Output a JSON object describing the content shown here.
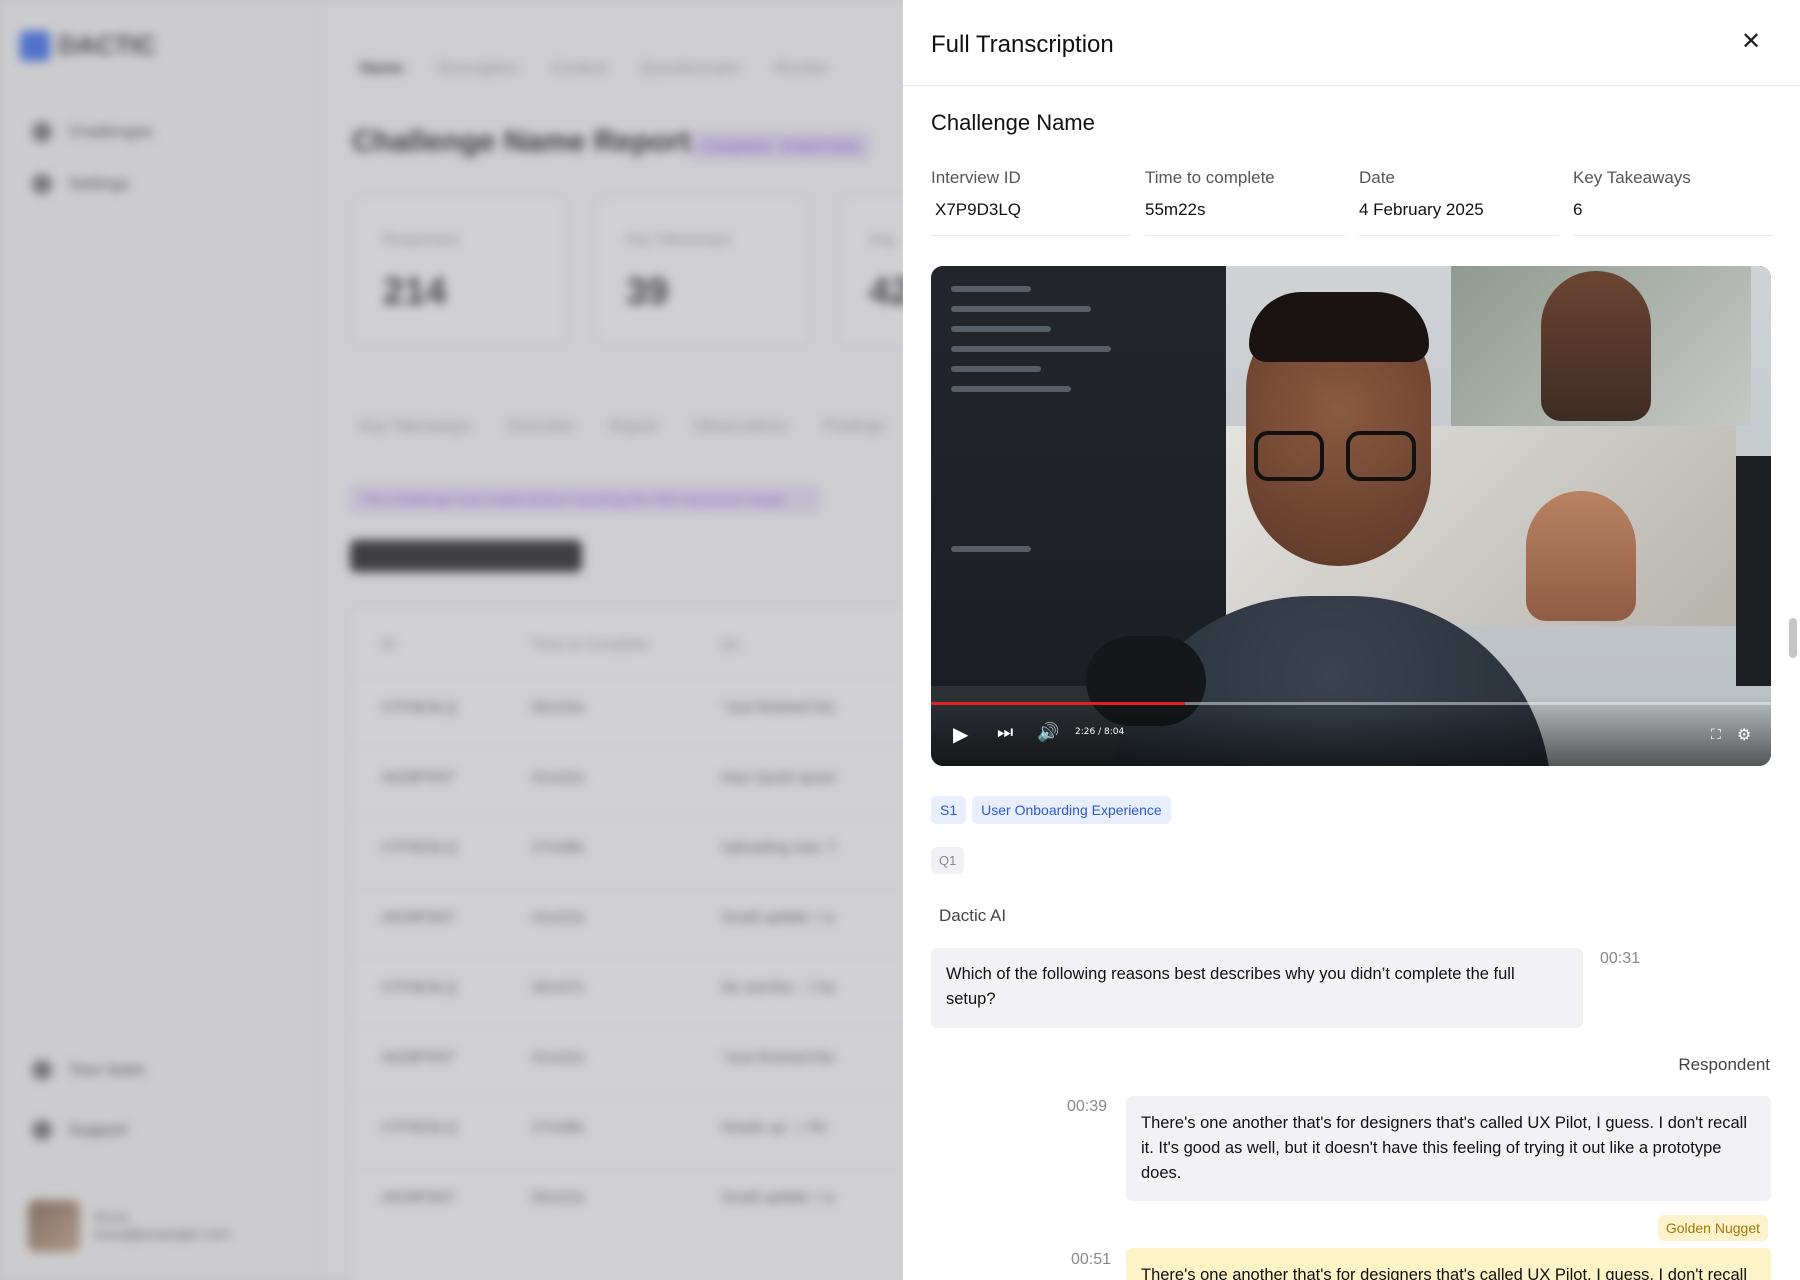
{
  "background": {
    "brand": "DACTIC",
    "nav": [
      "Challenges",
      "Settings"
    ],
    "bottom_nav": [
      "Your team",
      "Support"
    ],
    "user": {
      "name": "Erica",
      "email": "erica@example.com"
    },
    "breadcrumbs": [
      "Name",
      "Description",
      "Context",
      "Questionnaire",
      "Review"
    ],
    "page_title": "Challenge Name Report",
    "status_badge": "Completed · Ended Early",
    "cards": [
      {
        "label": "Responses",
        "value": "214"
      },
      {
        "label": "Key Takeaways",
        "value": "39"
      },
      {
        "label": "Avg",
        "value": "42"
      }
    ],
    "tabs": [
      "Key Takeaways",
      "Overview",
      "Report",
      "Observations",
      "Findings"
    ],
    "notice": "This Challenge was ended before reaching the 300 responses target",
    "download_label": "Download Raw Responses",
    "table_headers": [
      "ID",
      "Time to Complete",
      "Q1"
    ],
    "table_rows": [
      [
        "X7P9D3LQ",
        "55m22s",
        "\"Just finished the"
      ],
      [
        "A6Z8P5NT",
        "41m22s",
        "Hey! Quick quest"
      ],
      [
        "X7P9D3LQ",
        "27m08s",
        "Uploading now. T"
      ],
      [
        "A6Z8P5NT",
        "41m22s",
        "Small update: I a"
      ],
      [
        "X7P9D3LQ",
        "32m47s",
        "No worries – I ha"
      ],
      [
        "A6Z8P5NT",
        "41m22s",
        "\"Just finished the"
      ],
      [
        "X7P9D3LQ",
        "27m08s",
        "Heads up – I thi"
      ],
      [
        "A6Z8P5NT",
        "55m22s",
        "Small update: I a"
      ]
    ]
  },
  "drawer": {
    "title": "Full Transcription",
    "close_icon": "close-icon",
    "challenge_name": "Challenge Name",
    "meta": [
      {
        "label": "Interview ID",
        "value": "X7P9D3LQ"
      },
      {
        "label": "Time to complete",
        "value": "55m22s"
      },
      {
        "label": "Date",
        "value": "4 February 2025"
      },
      {
        "label": "Key Takeaways",
        "value": "6"
      }
    ],
    "video": {
      "time": "2:26 / 8:04",
      "progress_fraction": 0.302
    },
    "section_tag": "S1",
    "section_label": "User Onboarding Experience",
    "question_tag": "Q1",
    "messages": [
      {
        "speaker": "Dactic AI",
        "time": "00:31",
        "text": "Which of the following reasons best describes why you didn’t complete the full setup?"
      },
      {
        "speaker": "Respondent",
        "time": "00:39",
        "text": "There's one another that's for designers that's called UX Pilot, I guess. I don't recall it. It's good as well, but it doesn't have this feeling of trying it out like a prototype does."
      },
      {
        "badge": "Golden Nugget",
        "time": "00:51",
        "text": "There's one another that's for designers that's called UX Pilot, I guess. I don't recall it. It's good as well, but it doesn't have this feeling of trying it out like a prototype does."
      }
    ],
    "colors": {
      "tag_bg": "#e8eefb",
      "tag_text": "#2c5bd8",
      "nugget_bg": "#fcf3cc",
      "progress": "#e32020"
    }
  }
}
